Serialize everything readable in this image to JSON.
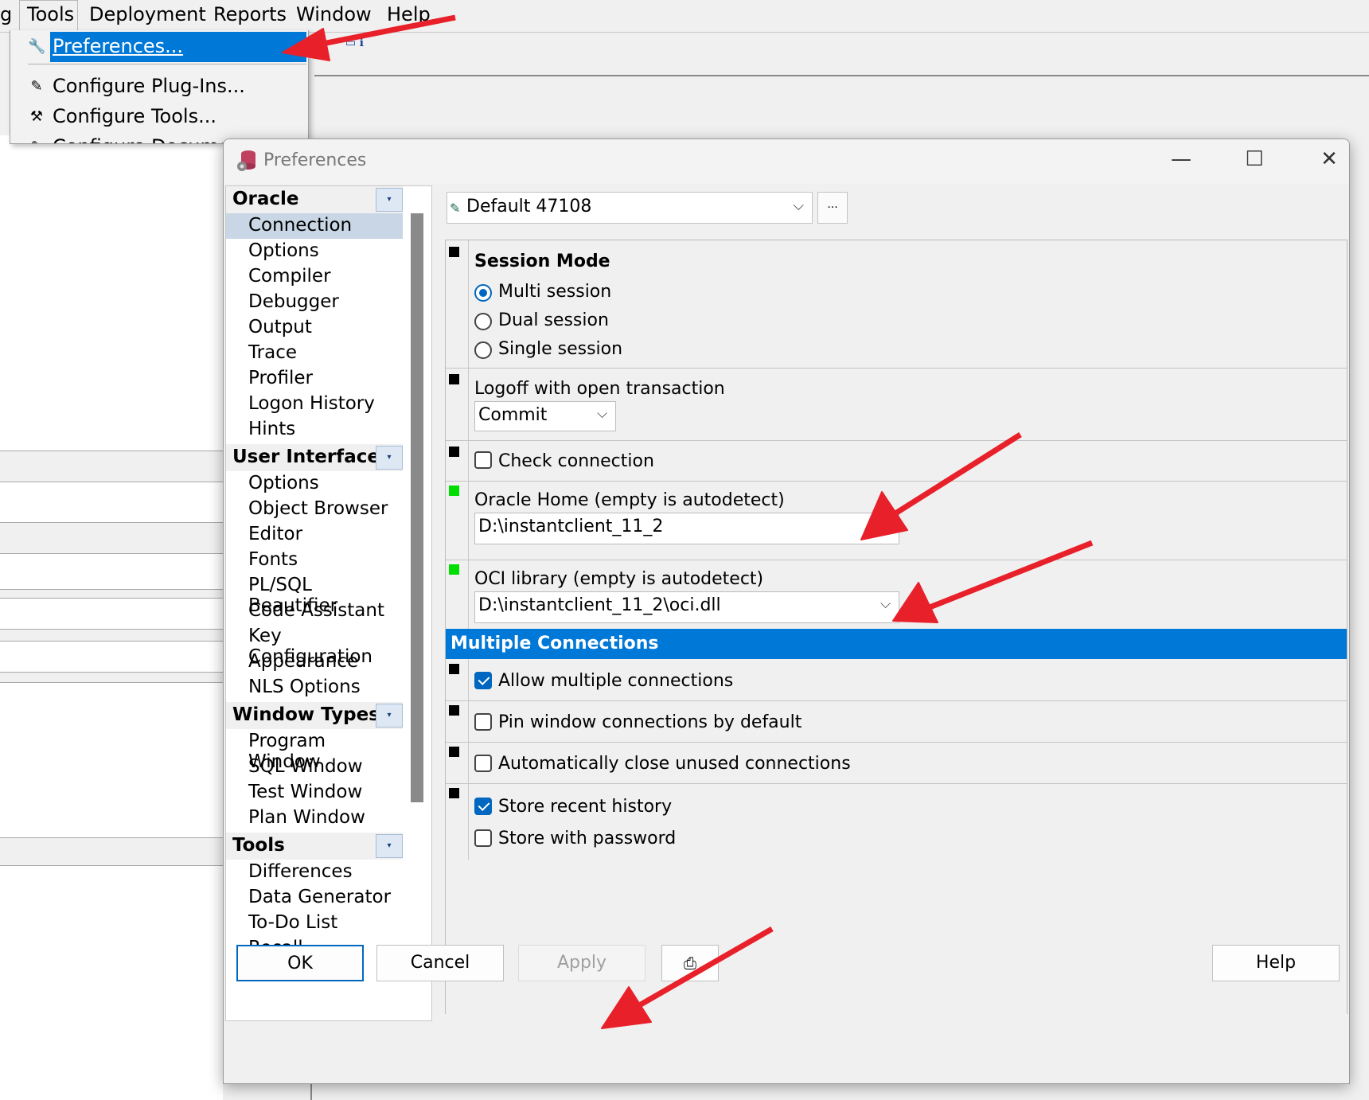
{
  "menubar": {
    "items": [
      "g",
      "Tools",
      "Deployment",
      "Reports",
      "Window",
      "Help"
    ]
  },
  "tools_menu": {
    "items": [
      {
        "label": "Preferences...",
        "icon": "wrench-icon",
        "highlighted": true
      },
      {
        "label": "Configure Plug-Ins...",
        "icon": "plugin-icon"
      },
      {
        "label": "Configure Tools...",
        "icon": "tools-icon"
      },
      {
        "label": "Configure Documents...",
        "icon": "document-icon"
      }
    ]
  },
  "dialog": {
    "title": "Preferences",
    "minimize_icon": "—",
    "maximize_icon": "☐",
    "close_icon": "✕"
  },
  "tree": {
    "categories": [
      {
        "label": "Oracle",
        "items": [
          "Connection",
          "Options",
          "Compiler",
          "Debugger",
          "Output",
          "Trace",
          "Profiler",
          "Logon History",
          "Hints"
        ]
      },
      {
        "label": "User Interface",
        "items": [
          "Options",
          "Object Browser",
          "Editor",
          "Fonts",
          "PL/SQL Beautifier",
          "Code Assistant",
          "Key Configuration",
          "Appearance",
          "NLS Options"
        ]
      },
      {
        "label": "Window Types",
        "items": [
          "Program Window",
          "SQL Window",
          "Test Window",
          "Plan Window"
        ]
      },
      {
        "label": "Tools",
        "items": [
          "Differences",
          "Data Generator",
          "To-Do List",
          "Recall Statement"
        ]
      }
    ],
    "selected": "Connection"
  },
  "profile": {
    "value": "Default 47108",
    "more_label": "..."
  },
  "settings": {
    "session_mode": {
      "title": "Session Mode",
      "options": [
        "Multi session",
        "Dual session",
        "Single session"
      ],
      "selected": "Multi session"
    },
    "logoff": {
      "label": "Logoff with open transaction",
      "value": "Commit"
    },
    "check_connection": {
      "label": "Check connection",
      "checked": false
    },
    "oracle_home": {
      "label": "Oracle Home (empty is autodetect)",
      "value": "D:\\instantclient_11_2"
    },
    "oci_library": {
      "label": "OCI library (empty is autodetect)",
      "value": "D:\\instantclient_11_2\\oci.dll"
    },
    "multiple_connections": {
      "title": "Multiple Connections",
      "allow": {
        "label": "Allow multiple connections",
        "checked": true
      },
      "pin": {
        "label": "Pin window connections by default",
        "checked": false
      },
      "auto_close": {
        "label": "Automatically close unused connections",
        "checked": false
      },
      "store_history": {
        "label": "Store recent history",
        "checked": true
      },
      "store_password": {
        "label": "Store with password",
        "checked": false
      }
    }
  },
  "buttons": {
    "ok": "OK",
    "cancel": "Cancel",
    "apply": "Apply",
    "help": "Help"
  },
  "colors": {
    "accent": "#0078d7",
    "changed_marker": "#00dd00",
    "default_marker": "#000000",
    "annotation_arrow": "#e8202a"
  }
}
